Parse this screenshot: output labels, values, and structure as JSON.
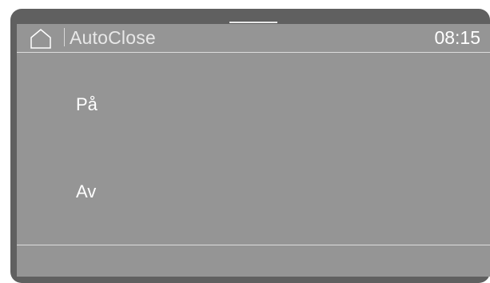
{
  "header": {
    "home_icon": "home-icon",
    "title": "AutoClose",
    "time": "08:15"
  },
  "options": [
    {
      "label": "På"
    },
    {
      "label": "Av"
    }
  ],
  "colors": {
    "bezel": "#606060",
    "screen": "#959595",
    "text": "#ffffff",
    "divider": "#dcdcdc"
  }
}
